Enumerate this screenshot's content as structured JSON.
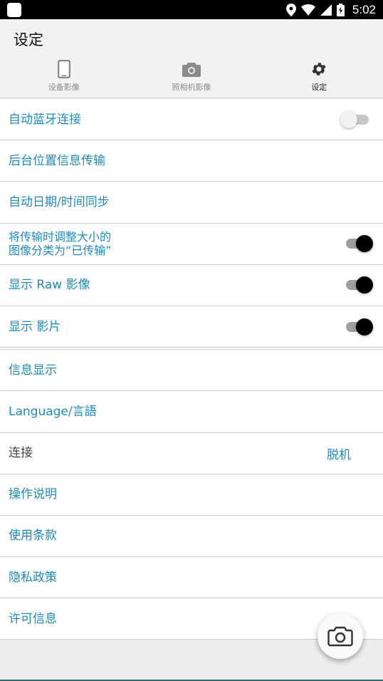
{
  "status_bar": {
    "time": "5:02"
  },
  "header": {
    "title": "设定",
    "tabs": [
      {
        "label": "设备影像",
        "icon": "phone-icon"
      },
      {
        "label": "照相机影像",
        "icon": "camera-icon"
      },
      {
        "label": "设定",
        "icon": "gear-icon"
      }
    ],
    "active_tab": 2
  },
  "settings": {
    "auto_bluetooth": {
      "label": "自动蓝牙连接",
      "toggle": false
    },
    "background_location": {
      "label": "后台位置信息传输"
    },
    "auto_datetime": {
      "label": "自动日期/时间同步"
    },
    "resize_transferred": {
      "label": "将传输时调整大小的\n图像分类为“已传输”",
      "toggle": true
    },
    "show_raw": {
      "label": "显示 Raw 影像",
      "toggle": true
    },
    "show_movies": {
      "label": "显示 影片",
      "toggle": true
    },
    "info_display": {
      "label": "信息显示"
    },
    "language": {
      "label": "Language/言語"
    },
    "connection": {
      "label": "连接",
      "value": "脱机"
    },
    "instructions": {
      "label": "操作说明"
    },
    "terms": {
      "label": "使用条款"
    },
    "privacy": {
      "label": "隐私政策"
    },
    "license": {
      "label": "许可信息"
    }
  },
  "colors": {
    "accent": "#1e8bbd",
    "toggle_on": "#000000",
    "toggle_off": "#f1f1f1"
  },
  "fab": {
    "icon": "camera-icon"
  }
}
